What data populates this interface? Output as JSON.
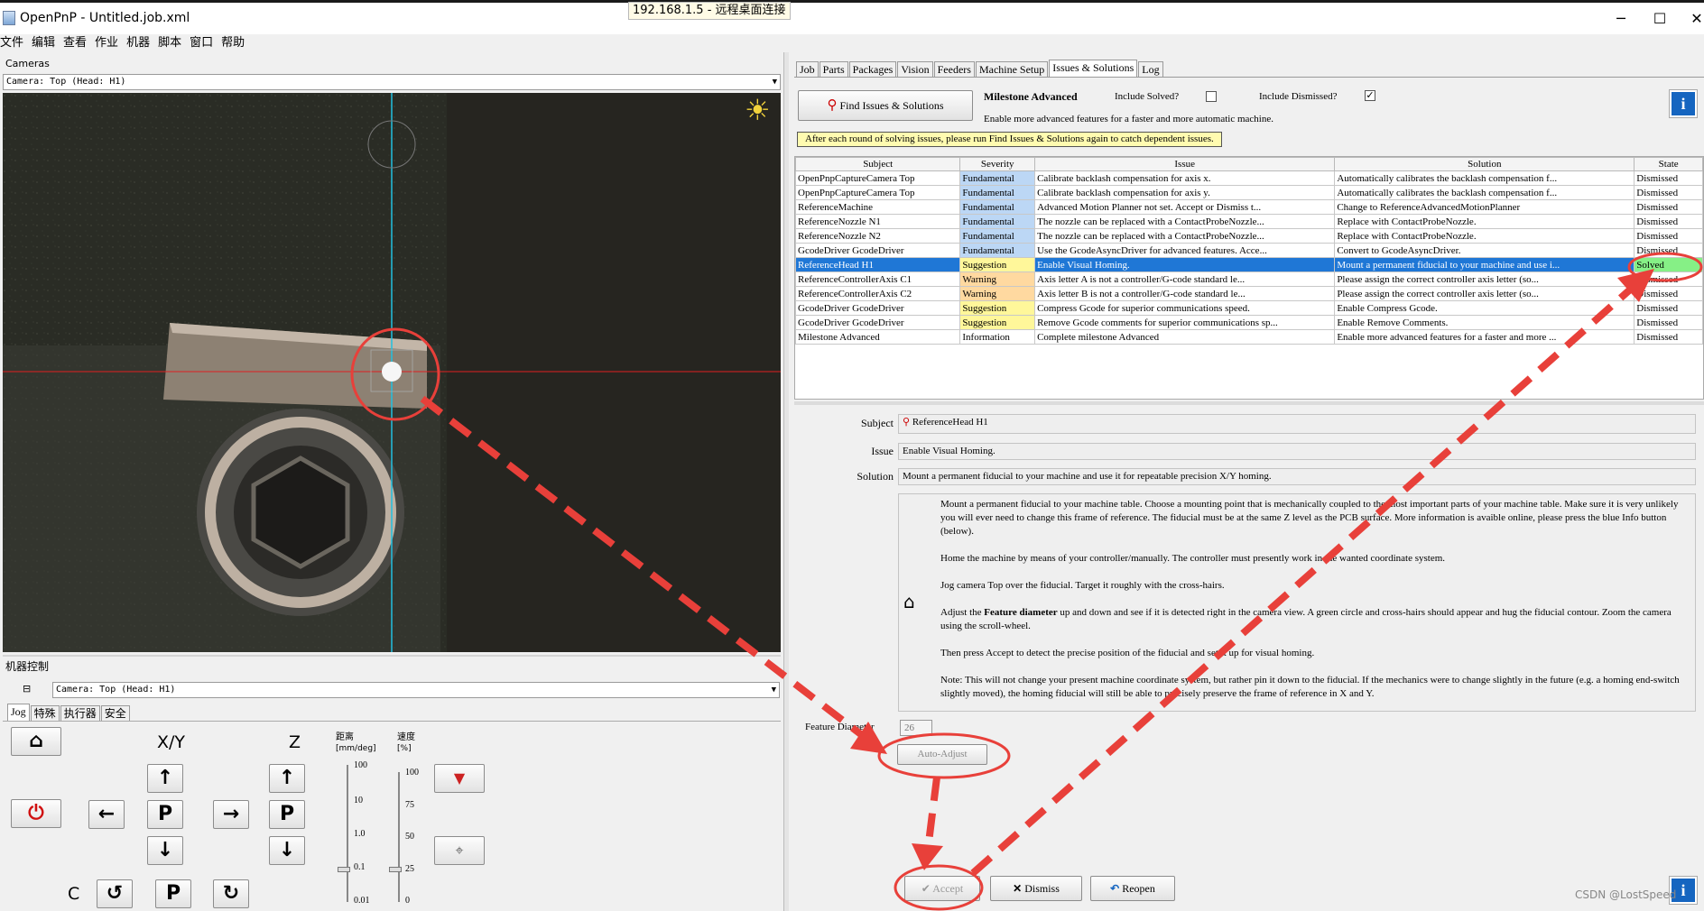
{
  "window": {
    "title": "OpenPnP - Untitled.job.xml",
    "minimize": "─",
    "maximize": "☐",
    "close": "✕",
    "remote_tooltip": "192.168.1.5 - 远程桌面连接"
  },
  "menu": [
    "文件",
    "编辑",
    "查看",
    "作业",
    "机器",
    "脚本",
    "窗口",
    "帮助"
  ],
  "cameras": {
    "group_label": "Cameras",
    "selected": "Camera: Top (Head: H1)"
  },
  "machine_control": {
    "group_label": "机器控制",
    "collapse": "⊟",
    "camera": "Camera: Top (Head: H1)",
    "tabs": [
      "Jog",
      "特殊",
      "执行器",
      "安全"
    ],
    "xy_label": "X/Y",
    "z_label": "Z",
    "c_label": "C",
    "distance_label": "距离",
    "distance_unit": "[mm/deg]",
    "speed_label": "速度",
    "speed_unit": "[%]",
    "distance_ticks": [
      "100",
      "10",
      "1.0",
      "0.1",
      "0.01"
    ],
    "speed_ticks": [
      "100",
      "75",
      "50",
      "25",
      "0"
    ],
    "distance_value": "0.1",
    "speed_value": 25,
    "park": "P",
    "arrows": {
      "up": "↑",
      "down": "↓",
      "left": "←",
      "right": "→",
      "ccw": "↺",
      "cw": "↻"
    }
  },
  "tabs": [
    "Job",
    "Parts",
    "Packages",
    "Vision",
    "Feeders",
    "Machine Setup",
    "Issues & Solutions",
    "Log"
  ],
  "selected_tab": "Issues & Solutions",
  "issues": {
    "find_button": "Find Issues & Solutions",
    "milestone_title": "Milestone Advanced",
    "milestone_desc": "Enable more advanced features for a faster and more automatic machine.",
    "include_solved_label": "Include Solved?",
    "include_solved": false,
    "include_dismissed_label": "Include Dismissed?",
    "include_dismissed": true,
    "notice": "After each round of solving issues, please run Find Issues & Solutions again to catch dependent issues.",
    "columns": [
      "Subject",
      "Severity",
      "Issue",
      "Solution",
      "State"
    ],
    "rows": [
      {
        "subject": "OpenPnpCaptureCamera Top",
        "severity": "Fundamental",
        "issue": "Calibrate backlash compensation for axis x.",
        "solution": "Automatically calibrates the backlash compensation f...",
        "state": "Dismissed"
      },
      {
        "subject": "OpenPnpCaptureCamera Top",
        "severity": "Fundamental",
        "issue": "Calibrate backlash compensation for axis y.",
        "solution": "Automatically calibrates the backlash compensation f...",
        "state": "Dismissed"
      },
      {
        "subject": "ReferenceMachine",
        "severity": "Fundamental",
        "issue": "Advanced Motion Planner not set. Accept or Dismiss t...",
        "solution": "Change to ReferenceAdvancedMotionPlanner",
        "state": "Dismissed"
      },
      {
        "subject": "ReferenceNozzle N1",
        "severity": "Fundamental",
        "issue": "The nozzle can be replaced with a ContactProbeNozzle...",
        "solution": "Replace with ContactProbeNozzle.",
        "state": "Dismissed"
      },
      {
        "subject": "ReferenceNozzle N2",
        "severity": "Fundamental",
        "issue": "The nozzle can be replaced with a ContactProbeNozzle...",
        "solution": "Replace with ContactProbeNozzle.",
        "state": "Dismissed"
      },
      {
        "subject": "GcodeDriver GcodeDriver",
        "severity": "Fundamental",
        "issue": "Use the GcodeAsyncDriver for advanced features. Acce...",
        "solution": "Convert to GcodeAsyncDriver.",
        "state": "Dismissed"
      },
      {
        "subject": "ReferenceHead H1",
        "severity": "Suggestion",
        "issue": "Enable Visual Homing.",
        "solution": "Mount a permanent fiducial to your machine and use i...",
        "state": "Solved"
      },
      {
        "subject": "ReferenceControllerAxis C1",
        "severity": "Warning",
        "issue": "Axis letter A is not a controller/G-code standard le...",
        "solution": "Please assign the correct controller axis letter (so...",
        "state": "Dismissed"
      },
      {
        "subject": "ReferenceControllerAxis C2",
        "severity": "Warning",
        "issue": "Axis letter B is not a controller/G-code standard le...",
        "solution": "Please assign the correct controller axis letter (so...",
        "state": "Dismissed"
      },
      {
        "subject": "GcodeDriver GcodeDriver",
        "severity": "Suggestion",
        "issue": "Compress Gcode for superior communications speed.",
        "solution": "Enable Compress Gcode.",
        "state": "Dismissed"
      },
      {
        "subject": "GcodeDriver GcodeDriver",
        "severity": "Suggestion",
        "issue": "Remove Gcode comments for superior communications sp...",
        "solution": "Enable Remove Comments.",
        "state": "Dismissed"
      },
      {
        "subject": "Milestone Advanced",
        "severity": "Information",
        "issue": "Complete milestone Advanced",
        "solution": "Enable more advanced features for a faster and more ...",
        "state": "Dismissed"
      }
    ],
    "severity_colors": {
      "Fundamental": "#bcd7f5",
      "Suggestion": "#fff79a",
      "Warning": "#ffd9a0",
      "Information": "#ffffff"
    },
    "solved_color": "#86f086"
  },
  "detail": {
    "subject_label": "Subject",
    "subject": "ReferenceHead H1",
    "issue_label": "Issue",
    "issue": "Enable Visual Homing.",
    "solution_label": "Solution",
    "solution": "Mount a permanent fiducial to your machine and use it for repeatable precision X/Y homing.",
    "description": [
      "Mount a permanent fiducial to your machine table. Choose a mounting point that is mechanically coupled to the most important parts of your machine table. Make sure it is very unlikely you will ever need to change this frame of reference. The fiducial must be at the same Z level as the PCB surface. More information is avaible online, please press the blue Info button (below).",
      "Home the machine by means of your controller/manually. The controller must presently work in the wanted coordinate system.",
      "Jog camera Top over the fiducial. Target it roughly with the cross-hairs.",
      "Adjust the Feature diameter up and down and see if it is detected right in the camera view. A green circle and cross-hairs should appear and hug the fiducial contour. Zoom the camera using the scroll-wheel.",
      "Then press Accept to detect the precise position of the fiducial and set it up for visual homing.",
      "Note: This will not change your present machine coordinate system, but rather pin it down to the fiducial. If the mechanics were to change slightly in the future (e.g. a homing end-switch slightly moved), the homing fiducial will still be able to precisely preserve the frame of reference in X and Y."
    ],
    "bold_term": "Feature diameter",
    "feature_diameter_label": "Feature Diameter",
    "feature_diameter": "26",
    "auto_adjust": "Auto-Adjust",
    "accept": "Accept",
    "dismiss": "Dismiss",
    "reopen": "Reopen"
  },
  "watermark": "CSDN @LostSpeed",
  "colors": {
    "annotation": "#e8403a",
    "crosshair_v": "#22c0e0",
    "crosshair_h": "#e02020",
    "selection": "#1f77d6"
  }
}
